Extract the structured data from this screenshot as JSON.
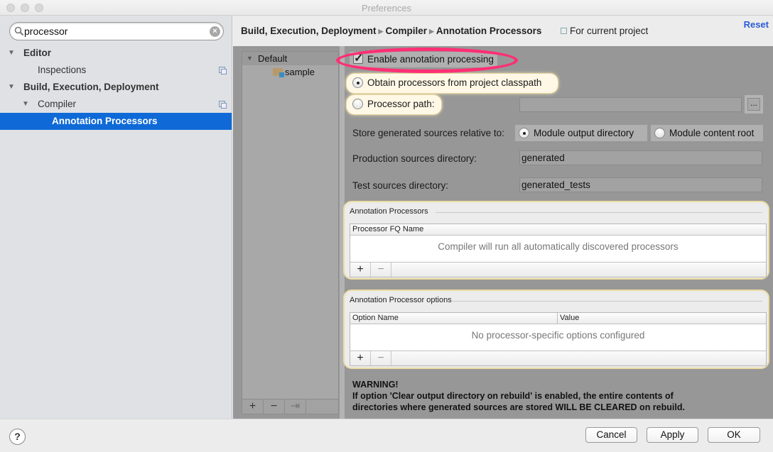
{
  "window": {
    "title": "Preferences"
  },
  "sidebar": {
    "search": {
      "value": "processor",
      "placeholder": ""
    },
    "items": [
      {
        "label": "Editor",
        "level": 0,
        "expanded": true
      },
      {
        "label": "Inspections",
        "level": 1
      },
      {
        "label": "Build, Execution, Deployment",
        "level": 0,
        "expanded": true
      },
      {
        "label": "Compiler",
        "level": 1,
        "expanded": true
      },
      {
        "label": "Annotation Processors",
        "level": 2,
        "selected": true
      }
    ]
  },
  "header": {
    "breadcrumb": [
      "Build, Execution, Deployment",
      "Compiler",
      "Annotation Processors"
    ],
    "scope": "For current project",
    "reset": "Reset"
  },
  "modules": {
    "items": [
      {
        "label": "Default"
      },
      {
        "label": "sample"
      }
    ],
    "toolbar": {
      "add": "+",
      "remove": "−",
      "move": "⇥"
    }
  },
  "settings": {
    "enable_processing": {
      "label": "Enable annotation processing",
      "checked": true
    },
    "obtain_classpath": {
      "label": "Obtain processors from project classpath",
      "selected": true
    },
    "processor_path": {
      "label": "Processor path:",
      "selected": false,
      "value": "",
      "browse": "..."
    },
    "store_relative": {
      "label": "Store generated sources relative to:",
      "options": [
        {
          "label": "Module output directory",
          "selected": true
        },
        {
          "label": "Module content root",
          "selected": false
        }
      ]
    },
    "production_dir": {
      "label": "Production sources directory:",
      "value": "generated"
    },
    "test_dir": {
      "label": "Test sources directory:",
      "value": "generated_tests"
    }
  },
  "processors_panel": {
    "title": "Annotation Processors",
    "column": "Processor FQ Name",
    "empty": "Compiler will run all automatically discovered processors",
    "add": "+",
    "remove": "−"
  },
  "options_panel": {
    "title": "Annotation Processor options",
    "columns": [
      "Option Name",
      "Value"
    ],
    "empty": "No processor-specific options configured",
    "add": "+",
    "remove": "−"
  },
  "warning": {
    "title": "WARNING!",
    "line1": "If option 'Clear output directory on rebuild' is enabled, the entire contents of",
    "line2": "directories where generated sources are stored WILL BE CLEARED on rebuild."
  },
  "footer": {
    "help": "?",
    "cancel": "Cancel",
    "apply": "Apply",
    "ok": "OK"
  },
  "colors": {
    "selection": "#0f6ad8",
    "highlight_ring": "#ff2f74",
    "reset_link": "#2a5bd7"
  }
}
